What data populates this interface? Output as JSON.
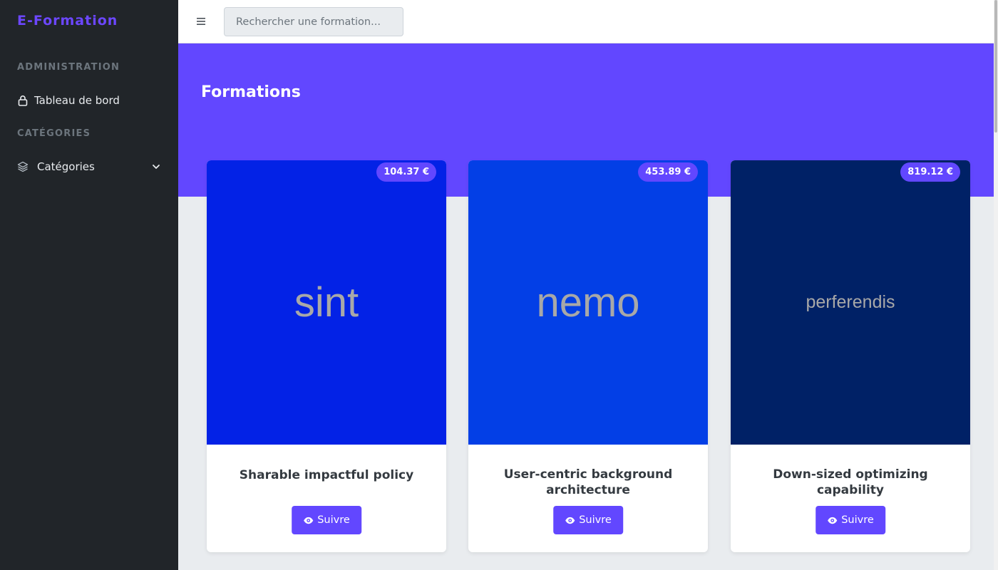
{
  "sidebar": {
    "brand": "E-Formation",
    "sections": [
      {
        "heading": "ADMINISTRATION",
        "items": [
          {
            "label": "Tableau de bord",
            "icon": "lock-icon"
          }
        ]
      },
      {
        "heading": "CATÉGORIES",
        "items": [
          {
            "label": "Catégories",
            "icon": "layers-icon",
            "expandable": true
          }
        ]
      }
    ]
  },
  "topbar": {
    "search_placeholder": "Rechercher une formation..."
  },
  "hero": {
    "title": "Formations"
  },
  "courses": [
    {
      "image_text": "sint",
      "image_bg": "#0322e6",
      "price": "104.37 €",
      "title": "Sharable impactful policy",
      "button": "Suivre"
    },
    {
      "image_text": "nemo",
      "image_bg": "#033fe6",
      "price": "453.89 €",
      "title": "User-centric background architecture",
      "button": "Suivre"
    },
    {
      "image_text": "perferendis",
      "image_bg": "#002166",
      "price": "819.12 €",
      "title": "Down-sized optimizing capability",
      "button": "Suivre"
    }
  ],
  "colors": {
    "accent": "#6247ff",
    "sidebar_bg": "#212529",
    "page_bg": "#e9ecef"
  }
}
